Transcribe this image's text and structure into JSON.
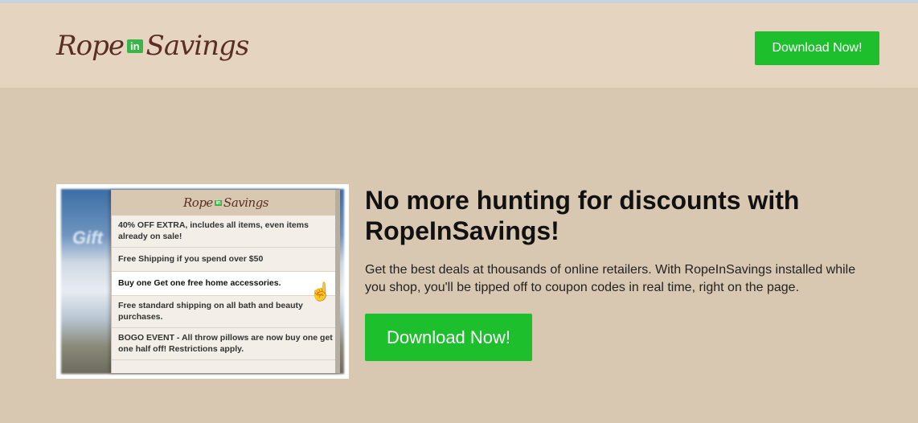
{
  "brand": {
    "logo_part1": "Rope",
    "logo_in": "in",
    "logo_part2": "Savings"
  },
  "header": {
    "download_label": "Download Now!"
  },
  "preview": {
    "bg_text": "Gift",
    "logo_part1": "Rope",
    "logo_in": "in",
    "logo_part2": "Savings",
    "deals": [
      "40% OFF EXTRA, includes all items, even items already on sale!",
      "Free Shipping if you spend over $50",
      "Buy one Get one free home accessories.",
      "Free standard shipping on all bath and beauty purchases.",
      "BOGO EVENT - All throw pillows are now buy one get one half off! Restrictions apply."
    ]
  },
  "hero": {
    "headline": "No more hunting for discounts with RopeInSavings!",
    "description": "Get the best deals at thousands of online retailers. With RopeInSavings installed while you shop, you'll be tipped off to coupon codes in real time, right on the page.",
    "download_label": "Download Now!"
  },
  "colors": {
    "accent_green": "#1dbf2d",
    "header_bg": "#e5d5c0",
    "body_bg": "#d9c8b1",
    "logo_brown": "#5a2e23"
  }
}
